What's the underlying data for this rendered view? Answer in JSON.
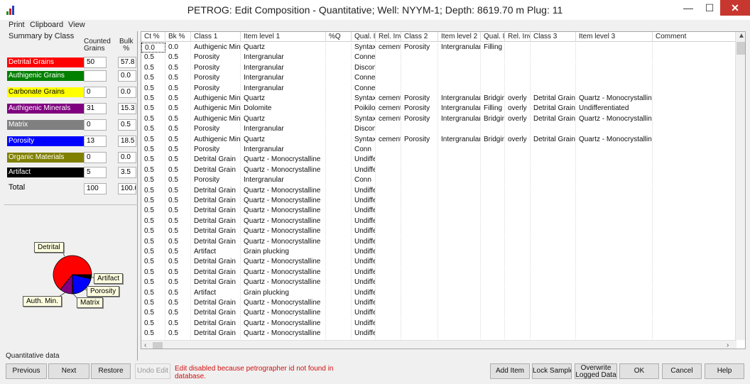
{
  "window": {
    "title": "PETROG: Edit Composition - Quantitative; Well: NYYM-1; Depth:  8619.70 m   Plug: 11",
    "minimize": "—",
    "maximize": "☐",
    "close": "✕"
  },
  "menu": [
    "Print",
    "Clipboard",
    "View"
  ],
  "summary": {
    "title": "Summary by Class",
    "count_header": [
      "Counted",
      "Grains"
    ],
    "pct_header": [
      "Bulk",
      "%"
    ],
    "classes": [
      {
        "label": "Detrital Grains",
        "color": "#ff0000",
        "text_color": "#ffffff",
        "count": "50",
        "pct": "57.8"
      },
      {
        "label": "Authigenic Grains",
        "color": "#008000",
        "text_color": "#ffffff",
        "count": "",
        "pct": "0.0"
      },
      {
        "label": "Carbonate Grains",
        "color": "#ffff00",
        "text_color": "#000000",
        "count": "0",
        "pct": "0.0"
      },
      {
        "label": "Authigenic Minerals",
        "color": "#800080",
        "text_color": "#ffffff",
        "count": "31",
        "pct": "15.3"
      },
      {
        "label": "Matrix",
        "color": "#808080",
        "text_color": "#ffffff",
        "count": "0",
        "pct": "0.5"
      },
      {
        "label": "Porosity",
        "color": "#0000ff",
        "text_color": "#ffffff",
        "count": "13",
        "pct": "18.5"
      },
      {
        "label": "Organic Materials",
        "color": "#808000",
        "text_color": "#ffffff",
        "count": "0",
        "pct": "0.0"
      },
      {
        "label": "Artifact",
        "color": "#000000",
        "text_color": "#ffffff",
        "count": "5",
        "pct": "3.5"
      }
    ],
    "total_label": "Total",
    "total_count": "100",
    "total_pct": "100.0"
  },
  "pie": {
    "labels": {
      "detrital": "Detrital",
      "artifact": "Artifact",
      "porosity": "Porosity",
      "authmin": "Auth. Min.",
      "matrix": "Matrix"
    }
  },
  "status": "Quantitative data",
  "grid": {
    "columns": [
      "Ct %",
      "Bk %",
      "Class 1",
      "Item level 1",
      "%Q",
      "Qual. In",
      "Rel. Inv",
      "Class 2",
      "Item level 2",
      "Qual. In",
      "Rel. Inv",
      "Class 3",
      "Item level 3",
      "Comment"
    ],
    "rows": [
      [
        "0.0",
        "0.0",
        "Authigenic Mine",
        "Quartz",
        "",
        "Syntaxial",
        "cement",
        "Porosity",
        "Intergranular",
        "Filling",
        "",
        "",
        "",
        ""
      ],
      [
        "0.5",
        "0.5",
        "Porosity",
        "Intergranular",
        "",
        "Connected",
        "",
        "",
        "",
        "",
        "",
        "",
        "",
        ""
      ],
      [
        "0.5",
        "0.5",
        "Porosity",
        "Intergranular",
        "",
        "Disconn",
        "",
        "",
        "",
        "",
        "",
        "",
        "",
        ""
      ],
      [
        "0.5",
        "0.5",
        "Porosity",
        "Intergranular",
        "",
        "Connected",
        "",
        "",
        "",
        "",
        "",
        "",
        "",
        ""
      ],
      [
        "0.5",
        "0.5",
        "Porosity",
        "Intergranular",
        "",
        "Connected",
        "",
        "",
        "",
        "",
        "",
        "",
        "",
        ""
      ],
      [
        "0.5",
        "0.5",
        "Authigenic Mine",
        "Quartz",
        "",
        "Syntaxial",
        "cement",
        "Porosity",
        "Intergranular",
        "Bridging",
        "overly",
        "Detrital Grain",
        "Quartz - Monocrystalline",
        ""
      ],
      [
        "0.5",
        "0.5",
        "Authigenic Mine",
        "Dolomite",
        "",
        "Poikilot",
        "cement",
        "Porosity",
        "Intergranular",
        "Filling",
        "overly",
        "Detrital Grain",
        "Undifferentiated",
        ""
      ],
      [
        "0.5",
        "0.5",
        "Authigenic Mine",
        "Quartz",
        "",
        "Syntaxial",
        "cement",
        "Porosity",
        "Intergranular",
        "Bridging",
        "overly",
        "Detrital Grain",
        "Quartz - Monocrystalline",
        ""
      ],
      [
        "0.5",
        "0.5",
        "Porosity",
        "Intergranular",
        "",
        "Disconn",
        "",
        "",
        "",
        "",
        "",
        "",
        "",
        ""
      ],
      [
        "0.5",
        "0.5",
        "Authigenic Mine",
        "Quartz",
        "",
        "Syntaxial",
        "cement",
        "Porosity",
        "Intergranular",
        "Bridging",
        "overly",
        "Detrital Grain",
        "Quartz - Monocrystalline",
        ""
      ],
      [
        "0.5",
        "0.5",
        "Porosity",
        "Intergranular",
        "",
        "Conn",
        "",
        "",
        "",
        "",
        "",
        "",
        "",
        ""
      ],
      [
        "0.5",
        "0.5",
        "Detrital Grain",
        "Quartz - Monocrystalline",
        "",
        "Undiffe",
        "",
        "",
        "",
        "",
        "",
        "",
        "",
        ""
      ],
      [
        "0.5",
        "0.5",
        "Detrital Grain",
        "Quartz - Monocrystalline",
        "",
        "Undiffe",
        "",
        "",
        "",
        "",
        "",
        "",
        "",
        ""
      ],
      [
        "0.5",
        "0.5",
        "Porosity",
        "Intergranular",
        "",
        "Conn",
        "",
        "",
        "",
        "",
        "",
        "",
        "",
        ""
      ],
      [
        "0.5",
        "0.5",
        "Detrital Grain",
        "Quartz - Monocrystalline",
        "",
        "Undiffe",
        "",
        "",
        "",
        "",
        "",
        "",
        "",
        ""
      ],
      [
        "0.5",
        "0.5",
        "Detrital Grain",
        "Quartz - Monocrystalline",
        "",
        "Undiffe",
        "",
        "",
        "",
        "",
        "",
        "",
        "",
        ""
      ],
      [
        "0.5",
        "0.5",
        "Detrital Grain",
        "Quartz - Monocrystalline",
        "",
        "Undiffe",
        "",
        "",
        "",
        "",
        "",
        "",
        "",
        ""
      ],
      [
        "0.5",
        "0.5",
        "Detrital Grain",
        "Quartz - Monocrystalline",
        "",
        "Undiffe",
        "",
        "",
        "",
        "",
        "",
        "",
        "",
        ""
      ],
      [
        "0.5",
        "0.5",
        "Detrital Grain",
        "Quartz - Monocrystalline",
        "",
        "Undiffe",
        "",
        "",
        "",
        "",
        "",
        "",
        "",
        ""
      ],
      [
        "0.5",
        "0.5",
        "Detrital Grain",
        "Quartz - Monocrystalline",
        "",
        "Undiffe",
        "",
        "",
        "",
        "",
        "",
        "",
        "",
        ""
      ],
      [
        "0.5",
        "0.5",
        "Artifact",
        "Grain plucking",
        "",
        "Undiffe",
        "",
        "",
        "",
        "",
        "",
        "",
        "",
        ""
      ],
      [
        "0.5",
        "0.5",
        "Detrital Grain",
        "Quartz - Monocrystalline",
        "",
        "Undiffe",
        "",
        "",
        "",
        "",
        "",
        "",
        "",
        ""
      ],
      [
        "0.5",
        "0.5",
        "Detrital Grain",
        "Quartz - Monocrystalline",
        "",
        "Undiffe",
        "",
        "",
        "",
        "",
        "",
        "",
        "",
        ""
      ],
      [
        "0.5",
        "0.5",
        "Detrital Grain",
        "Quartz - Monocrystalline",
        "",
        "Undiffe",
        "",
        "",
        "",
        "",
        "",
        "",
        "",
        ""
      ],
      [
        "0.5",
        "0.5",
        "Artifact",
        "Grain plucking",
        "",
        "Undiffe",
        "",
        "",
        "",
        "",
        "",
        "",
        "",
        ""
      ],
      [
        "0.5",
        "0.5",
        "Detrital Grain",
        "Quartz - Monocrystalline",
        "",
        "Undiffe",
        "",
        "",
        "",
        "",
        "",
        "",
        "",
        ""
      ],
      [
        "0.5",
        "0.5",
        "Detrital Grain",
        "Quartz - Monocrystalline",
        "",
        "Undiffe",
        "",
        "",
        "",
        "",
        "",
        "",
        "",
        ""
      ],
      [
        "0.5",
        "0.5",
        "Detrital Grain",
        "Quartz - Monocrystalline",
        "",
        "Undiffe",
        "",
        "",
        "",
        "",
        "",
        "",
        "",
        ""
      ],
      [
        "0.5",
        "0.5",
        "Detrital Grain",
        "Quartz - Monocrystalline",
        "",
        "Undiffe",
        "",
        "",
        "",
        "",
        "",
        "",
        "",
        ""
      ],
      [
        "0.5",
        "0.5",
        "Detrital Grain",
        "Quartz - Monocrystalline",
        "",
        "Undiffe",
        "",
        "",
        "",
        "",
        "",
        "",
        "",
        ""
      ]
    ]
  },
  "buttons": {
    "previous": "Previous",
    "next": "Next",
    "restore": "Restore",
    "undo_edit": "Undo Edit",
    "warning": "Edit disabled because petrographer id not found in database.",
    "add_item": "Add Item",
    "lock_sample": "Lock Sample",
    "overwrite_1": "Overwrite",
    "overwrite_2": "Logged Data",
    "ok": "OK",
    "cancel": "Cancel",
    "help": "Help"
  }
}
